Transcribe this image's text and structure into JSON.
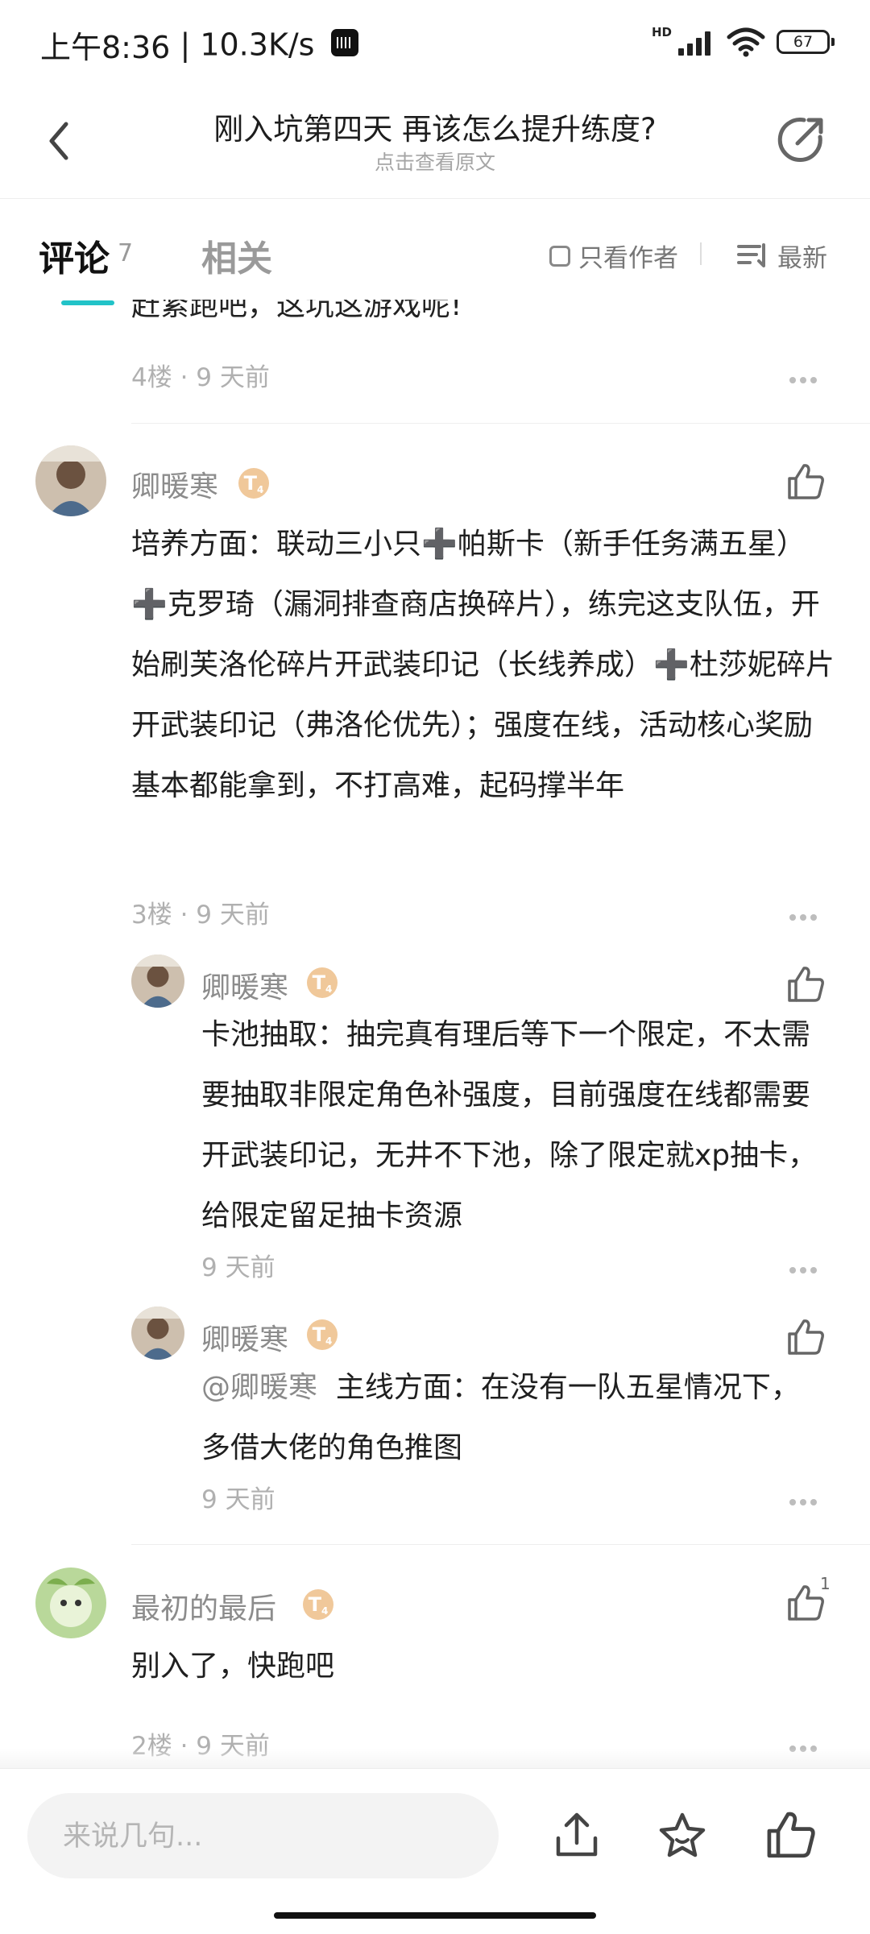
{
  "status_bar": {
    "time": "上午8:36",
    "network_speed": "10.3K/s",
    "hd_label": "HD",
    "battery": "67"
  },
  "header": {
    "title": "刚入坑第四天 再该怎么提升练度?",
    "subtitle": "点击查看原文"
  },
  "tabs": {
    "comments_label": "评论",
    "comments_count": "7",
    "related_label": "相关",
    "author_only_label": "只看作者",
    "sort_label": "最新"
  },
  "comments": [
    {
      "clipped_text": "赶紧跑吧，这坑这游戏呢!",
      "meta": "4楼 · 9 天前"
    },
    {
      "user": "卿暖寒",
      "badge": "T",
      "body": "培养方面：联动三小只➕帕斯卡（新手任务满五星）➕克罗琦（漏洞排查商店换碎片），练完这支队伍，开始刷芙洛伦碎片开武装印记（长线养成）➕杜莎妮碎片开武装印记（弗洛伦优先）；强度在线，活动核心奖励基本都能拿到，不打高难，起码撑半年",
      "meta": "3楼 · 9 天前",
      "replies": [
        {
          "user": "卿暖寒",
          "badge": "T",
          "body": "卡池抽取：抽完真有理后等下一个限定，不太需要抽取非限定角色补强度，目前强度在线都需要开武装印记，无井不下池，除了限定就xp抽卡，给限定留足抽卡资源",
          "meta": "9 天前"
        },
        {
          "user": "卿暖寒",
          "badge": "T",
          "mention": "@卿暖寒",
          "body": "主线方面：在没有一队五星情况下，多借大佬的角色推图",
          "meta": "9 天前"
        }
      ]
    },
    {
      "user": "最初的最后",
      "badge": "T",
      "body": "别入了，快跑吧",
      "like_count": "1",
      "meta": "2楼 · 9 天前"
    }
  ],
  "bottom_bar": {
    "input_placeholder": "来说几句..."
  },
  "colors": {
    "accent": "#22c3c8",
    "badge": "#f0c89a",
    "meta_text": "#b0b0b0"
  }
}
